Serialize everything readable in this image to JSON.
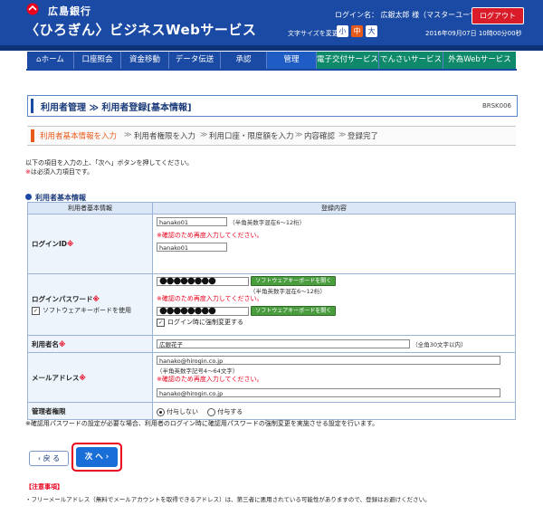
{
  "header": {
    "bank_name": "広島銀行",
    "service_name": "〈ひろぎん〉ビジネスWebサービス",
    "login_info": "ログイン名： 広銀太郎 様（マスターユーザ）",
    "logout_label": "ログアウト",
    "font_size_label": "文字サイズを変更",
    "font_sizes": [
      "小",
      "中",
      "大"
    ],
    "datetime": "2016年09月07日 10時00分00秒"
  },
  "nav": {
    "items": [
      {
        "label": "ホーム"
      },
      {
        "label": "口座照会"
      },
      {
        "label": "資金移動"
      },
      {
        "label": "データ伝送"
      },
      {
        "label": "承認"
      },
      {
        "label": "管理"
      },
      {
        "label": "電子交付サービス"
      },
      {
        "label": "でんさいサービス"
      },
      {
        "label": "外為Webサービス"
      }
    ]
  },
  "page": {
    "title": "利用者管理 ≫ 利用者登録[基本情報]",
    "screen_id": "BRSK006"
  },
  "steps": [
    {
      "label": "利用者基本情報を入力"
    },
    {
      "label": "利用者権限を入力"
    },
    {
      "label": "利用口座・限度額を入力"
    },
    {
      "label": "内容確認"
    },
    {
      "label": "登録完了"
    }
  ],
  "intro": {
    "line1": "以下の項目を入力の上、「次へ」ボタンを押してください。",
    "required_mark": "※",
    "line2": "は必須入力項目です。"
  },
  "section": {
    "title": "利用者基本情報"
  },
  "table": {
    "header_col1": "利用者基本情報",
    "header_col2": "登録内容",
    "login_id": {
      "label": "ログインID",
      "required": "※",
      "value": "hanako01",
      "hint": "（半角英数字混在6～12桁）",
      "confirm_msg": "※確認のため再度入力してください。",
      "confirm_value": "hanako01"
    },
    "password": {
      "label": "ログインパスワード",
      "required": "※",
      "kb_option": "ソフトウェアキーボードを使用",
      "mask": "●●●●●●●●",
      "kb_button": "ソフトウェアキーボードを開く",
      "hint": "（半角英数字混在6～12桁）",
      "confirm_msg": "※確認のため再度入力してください。",
      "force_change": "ログイン時に強制変更する"
    },
    "user_name": {
      "label": "利用者名",
      "required": "※",
      "value": "広銀花子",
      "hint": "（全角30文字以内）"
    },
    "email": {
      "label": "メールアドレス",
      "required": "※",
      "value": "hanako@hirogin.co.jp",
      "hint": "（半角英数字記号4～64文字）",
      "confirm_msg": "※確認のため再度入力してください。",
      "confirm_value": "hanako@hirogin.co.jp"
    },
    "admin": {
      "label": "管理者権限",
      "option_no": "付与しない",
      "option_yes": "付与する"
    }
  },
  "footnote": "※確認用パスワードの設定が必要な場合、利用者のログイン時に確認用パスワードの強制変更を実施させる設定を行います。",
  "buttons": {
    "back": "戻 る",
    "next": "次 へ"
  },
  "caution": {
    "title": "【注意事項】",
    "text": "・フリーメールアドレス（無料でメールアカウントを取得できるアドレス）は、第三者に悪用されている可能性がありますので、登録はお避けください。"
  },
  "colors": {
    "primary": "#1a4aa3",
    "accent_red": "#e8001c",
    "step_current": "#e85a1a",
    "kb_green": "#4a9c3f"
  }
}
